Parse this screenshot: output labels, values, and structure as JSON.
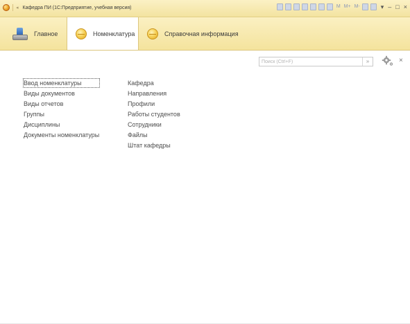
{
  "window": {
    "title": "Кафедра ПИ (1С:Предприятие, учебная версия)",
    "toolbar_labels": [
      "M",
      "M+",
      "M-"
    ],
    "window_controls": [
      "▾",
      "–",
      "□",
      "×"
    ],
    "colors": {
      "titlebar": "#f3e3a0",
      "tool_icons": "#cfd7e6"
    }
  },
  "sections": [
    {
      "label": "Главное",
      "icon": "home-desk-icon",
      "active": false
    },
    {
      "label": "Номенклатура",
      "icon": "yellow-ball-icon",
      "active": true
    },
    {
      "label": "Справочная информация",
      "icon": "yellow-ball-icon",
      "active": false
    }
  ],
  "search": {
    "placeholder": "Поиск (Ctrl+F)",
    "value": "",
    "button_label": "»"
  },
  "actions": {
    "settings_icon": "gear-icon",
    "close_label": "×"
  },
  "commands": {
    "column1": [
      "Ввод номенклатуры",
      "Виды документов",
      "Виды отчетов",
      "Группы",
      "Дисциплины",
      "Документы номенклатуры"
    ],
    "column2": [
      "Кафедра",
      "Направления",
      "Профили",
      "Работы студентов",
      "Сотрудники",
      "Файлы",
      "Штат кафедры"
    ]
  }
}
